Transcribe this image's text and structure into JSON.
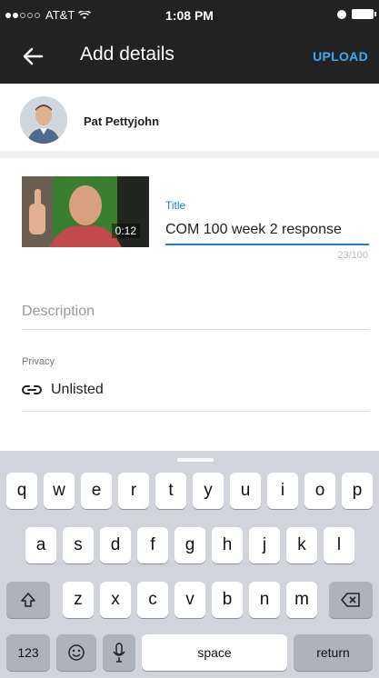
{
  "status_bar": {
    "carrier": "AT&T",
    "time": "1:08 PM"
  },
  "app_bar": {
    "title": "Add details",
    "upload_label": "UPLOAD"
  },
  "owner": {
    "name": "Pat Pettyjohn"
  },
  "video": {
    "duration": "0:12"
  },
  "form": {
    "title_label": "Title",
    "title_value": "COM 100 week 2 response",
    "title_counter": "23/100",
    "description_placeholder": "Description",
    "privacy_label": "Privacy",
    "privacy_value": "Unlisted"
  },
  "keyboard": {
    "row1": [
      "q",
      "w",
      "e",
      "r",
      "t",
      "y",
      "u",
      "i",
      "o",
      "p"
    ],
    "row2": [
      "a",
      "s",
      "d",
      "f",
      "g",
      "h",
      "j",
      "k",
      "l"
    ],
    "row3": [
      "z",
      "x",
      "c",
      "v",
      "b",
      "n",
      "m"
    ],
    "numbers_label": "123",
    "space_label": "space",
    "return_label": "return"
  },
  "colors": {
    "app_bar_bg": "#222222",
    "accent_blue": "#1f7fc4",
    "upload_blue": "#3fa9f5",
    "keyboard_bg": "#d1d5db"
  }
}
